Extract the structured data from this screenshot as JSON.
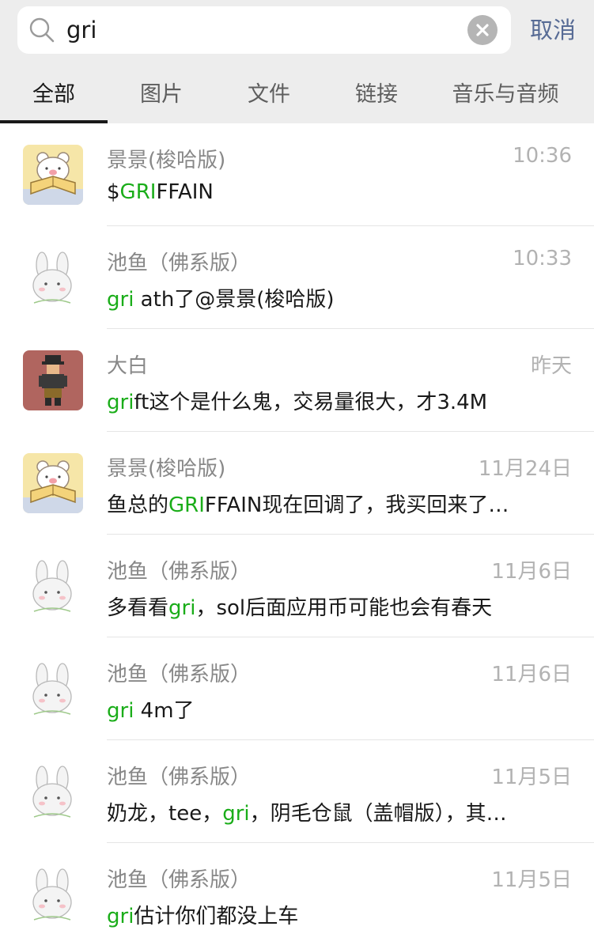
{
  "search": {
    "query": "gri",
    "cancel_label": "取消"
  },
  "tabs": [
    {
      "label": "全部"
    },
    {
      "label": "图片"
    },
    {
      "label": "文件"
    },
    {
      "label": "链接"
    },
    {
      "label": "音乐与音频"
    }
  ],
  "results": [
    {
      "name": "景景(梭哈版)",
      "time": "10:36",
      "avatar": "bear-reading-avatar",
      "pre": "$",
      "hl": "GRI",
      "post": "FFAIN"
    },
    {
      "name": "池鱼（佛系版）",
      "time": "10:33",
      "avatar": "bunny-avatar",
      "pre": "",
      "hl": "gri",
      "post": " ath了@景景(梭哈版)"
    },
    {
      "name": "大白",
      "time": "昨天",
      "avatar": "pixel-character-avatar",
      "pre": "",
      "hl": "gri",
      "post": "ft这个是什么鬼，交易量很大，才3.4M"
    },
    {
      "name": "景景(梭哈版)",
      "time": "11月24日",
      "avatar": "bear-reading-avatar",
      "pre": "鱼总的",
      "hl": "GRI",
      "post": "FFAIN现在回调了，我买回来了…"
    },
    {
      "name": "池鱼（佛系版）",
      "time": "11月6日",
      "avatar": "bunny-avatar",
      "pre": "多看看",
      "hl": "gri",
      "post": "，sol后面应用币可能也会有春天"
    },
    {
      "name": "池鱼（佛系版）",
      "time": "11月6日",
      "avatar": "bunny-avatar",
      "pre": "",
      "hl": "gri",
      "post": " 4m了"
    },
    {
      "name": "池鱼（佛系版）",
      "time": "11月5日",
      "avatar": "bunny-avatar",
      "pre": "奶龙，tee，",
      "hl": "gri",
      "post": "，阴毛仓鼠（盖帽版），其…"
    },
    {
      "name": "池鱼（佛系版）",
      "time": "11月5日",
      "avatar": "bunny-avatar",
      "pre": "",
      "hl": "gri",
      "post": "估计你们都没上车"
    }
  ],
  "colors": {
    "highlight": "#1aad19",
    "cancel": "#576b95",
    "topbar": "#ededed"
  }
}
